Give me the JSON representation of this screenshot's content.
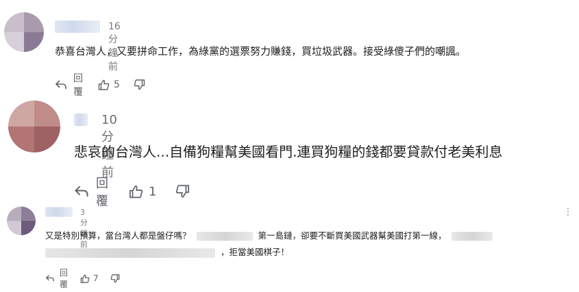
{
  "comments": [
    {
      "timestamp": "16 分鐘前",
      "text": "恭喜台灣人，又要拼命工作，為綠黨的選票努力賺錢，買垃圾武器。接受綠傻子們的嘲諷。",
      "reply_label": "回覆",
      "like_count": "5"
    },
    {
      "timestamp": "10 分鐘前",
      "text": "悲哀的台灣人...自備狗糧幫美國看門.連買狗糧的錢都要貸款付老美利息",
      "reply_label": "回覆",
      "like_count": "1"
    },
    {
      "timestamp": "3 分鐘前",
      "text_a": "又是特別預算，當台灣人都是盤仔嗎？",
      "text_b": "第一島鏈，卻要不斷買美國武器幫美國打第一線，",
      "text_c": "，拒當美國棋子！",
      "reply_label": "回覆",
      "like_count": "7",
      "more_label": "⋮"
    }
  ],
  "icons": {
    "reply": "reply-arrow-icon",
    "like": "thumbs-up-icon",
    "dislike": "thumbs-down-icon",
    "more": "more-options-icon"
  },
  "colors": {
    "text": "#1f1f1f",
    "meta": "#7a7a7a",
    "action": "#5f6368"
  }
}
